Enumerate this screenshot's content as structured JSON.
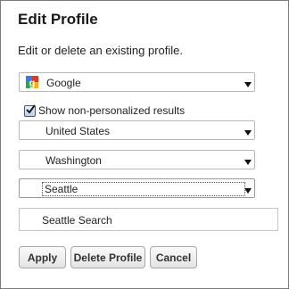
{
  "title": "Edit Profile",
  "subtitle": "Edit or delete an existing profile.",
  "search_engine": {
    "selected": "Google",
    "icon": "google-g-icon"
  },
  "non_personalized": {
    "label": "Show non-personalized results",
    "checked": true
  },
  "country": {
    "selected": "United States"
  },
  "state": {
    "selected": "Washington"
  },
  "city": {
    "selected": "Seattle"
  },
  "profile_name": {
    "value": "Seattle Search"
  },
  "buttons": {
    "apply": "Apply",
    "delete": "Delete Profile",
    "cancel": "Cancel"
  }
}
